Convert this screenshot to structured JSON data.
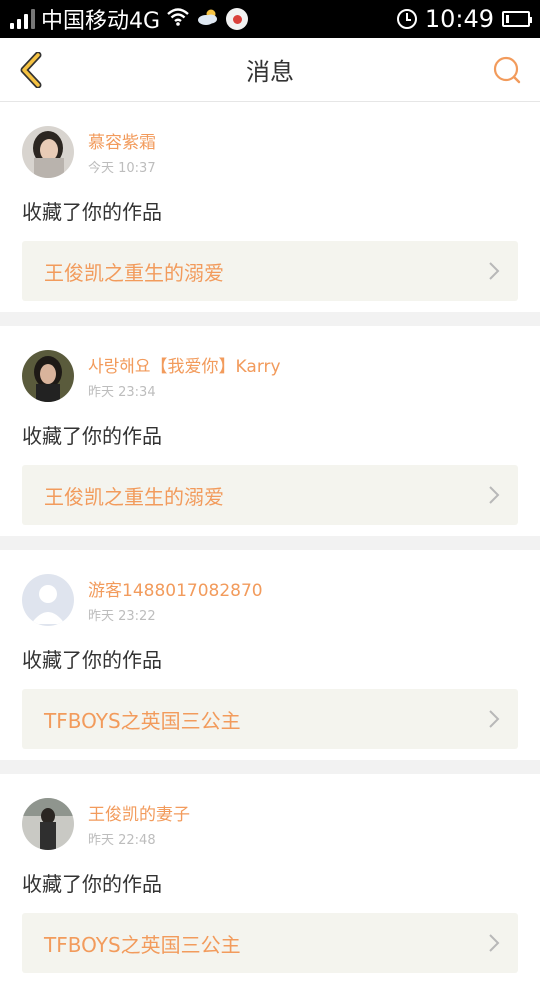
{
  "status_bar": {
    "carrier": "中国移动4G",
    "time": "10:49",
    "battery_level": 0.15
  },
  "header": {
    "title": "消息",
    "accent_color": "#f29b5c"
  },
  "messages": [
    {
      "username": "慕容紫霜",
      "time": "今天 10:37",
      "action": "收藏了你的作品",
      "work_title": "王俊凯之重生的溺爱"
    },
    {
      "username": "사랑해요【我爱你】Karry",
      "time": "昨天 23:34",
      "action": "收藏了你的作品",
      "work_title": "王俊凯之重生的溺爱"
    },
    {
      "username": "游客1488017082870",
      "time": "昨天 23:22",
      "action": "收藏了你的作品",
      "work_title": "TFBOYS之英国三公主"
    },
    {
      "username": "王俊凯的妻子",
      "time": "昨天 22:48",
      "action": "收藏了你的作品",
      "work_title": "TFBOYS之英国三公主"
    }
  ]
}
